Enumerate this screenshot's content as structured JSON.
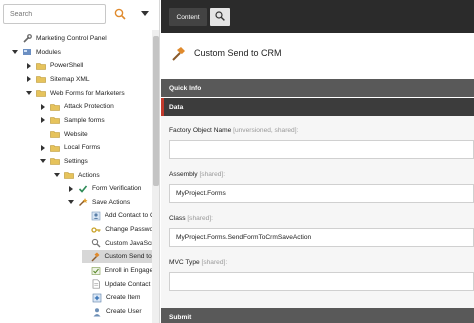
{
  "search": {
    "placeholder": "Search"
  },
  "tree": [
    {
      "label": "Marketing Control Panel",
      "toggle": "",
      "icon": "wrench-icon",
      "name": "tree-item-marketing-control-panel"
    },
    {
      "label": "Modules",
      "toggle": "minus",
      "icon": "modules-icon",
      "name": "tree-item-modules"
    },
    {
      "label": "PowerShell",
      "toggle": "plus",
      "icon": "folder-icon",
      "name": "tree-item-powershell"
    },
    {
      "label": "Sitemap XML",
      "toggle": "plus",
      "icon": "folder-icon",
      "name": "tree-item-sitemap-xml"
    },
    {
      "label": "Web Forms for Marketers",
      "toggle": "minus",
      "icon": "folder-icon",
      "name": "tree-item-web-forms-for-marketers"
    },
    {
      "label": "Attack Protection",
      "toggle": "plus",
      "icon": "folder-icon",
      "name": "tree-item-attack-protection"
    },
    {
      "label": "Sample forms",
      "toggle": "plus",
      "icon": "folder-icon",
      "name": "tree-item-sample-forms"
    },
    {
      "label": "Website",
      "toggle": "",
      "icon": "folder-icon",
      "name": "tree-item-website"
    },
    {
      "label": "Local Forms",
      "toggle": "plus",
      "icon": "folder-icon",
      "name": "tree-item-local-forms"
    },
    {
      "label": "Settings",
      "toggle": "minus",
      "icon": "folder-icon",
      "name": "tree-item-settings"
    },
    {
      "label": "Actions",
      "toggle": "minus",
      "icon": "folder-icon",
      "name": "tree-item-actions"
    },
    {
      "label": "Form Verification",
      "toggle": "plus",
      "icon": "check-icon",
      "name": "tree-item-form-verification"
    },
    {
      "label": "Save Actions",
      "toggle": "minus",
      "icon": "wand-icon",
      "name": "tree-item-save-actions"
    },
    {
      "label": "Add Contact to Conta",
      "toggle": "",
      "icon": "contact-icon",
      "name": "tree-item-add-contact"
    },
    {
      "label": "Change Password",
      "toggle": "",
      "icon": "key-icon",
      "name": "tree-item-change-password"
    },
    {
      "label": "Custom JavaScript",
      "toggle": "",
      "icon": "search-doc-icon",
      "name": "tree-item-custom-javascript"
    },
    {
      "label": "Custom Send to CRM",
      "toggle": "",
      "icon": "hammer-icon",
      "name": "tree-item-custom-send-to-crm",
      "selected": true
    },
    {
      "label": "Enroll in Engagemer",
      "toggle": "",
      "icon": "enroll-icon",
      "name": "tree-item-enroll-in-engagement"
    },
    {
      "label": "Update Contact Deta",
      "toggle": "",
      "icon": "doc-icon",
      "name": "tree-item-update-contact-details"
    },
    {
      "label": "Create Item",
      "toggle": "",
      "icon": "create-item-icon",
      "name": "tree-item-create-item"
    },
    {
      "label": "Create User",
      "toggle": "",
      "icon": "user-icon",
      "name": "tree-item-create-user"
    }
  ],
  "tabs": {
    "content_label": "Content"
  },
  "item": {
    "title": "Custom Send to CRM"
  },
  "sections": {
    "quick_info": "Quick Info",
    "data": "Data",
    "submit": "Submit"
  },
  "fields": {
    "factory": {
      "label": "Factory Object Name",
      "meta": "[unversioned, shared]:",
      "value": ""
    },
    "assembly": {
      "label": "Assembly",
      "meta": "[shared]:",
      "value": "MyProject.Forms"
    },
    "class": {
      "label": "Class",
      "meta": "[shared]:",
      "value": "MyProject.Forms.SendFormToCrmSaveAction"
    },
    "mvc_type": {
      "label": "MVC Type",
      "meta": "[shared]:",
      "value": ""
    }
  },
  "colors": {
    "accent": "#c0392b",
    "topbar": "#2b2b2b",
    "search_icon": "#e08a2c"
  }
}
